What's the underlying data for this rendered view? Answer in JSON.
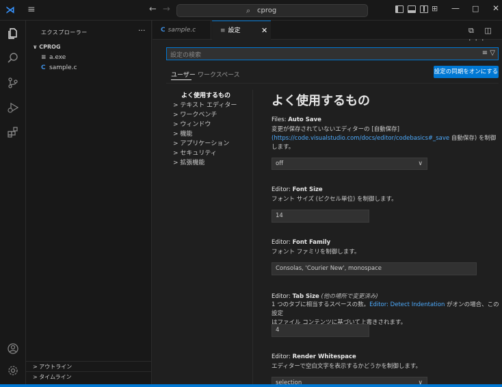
{
  "titlebar": {
    "search_text": "cprog",
    "back_label": "←",
    "forward_label": "→",
    "menu_glyph": "≡",
    "logo_glyph": "⋊",
    "layout_glyph": "⊞",
    "minimize_glyph": "—",
    "maximize_glyph": "□",
    "close_glyph": "✕"
  },
  "sidebar": {
    "title": "エクスプローラー",
    "more": "···",
    "folder": "∨ CPROG",
    "files": [
      {
        "icon": "≡",
        "name": "a.exe"
      },
      {
        "icon": "C",
        "name": "sample.c"
      }
    ],
    "sections": [
      "> アウトライン",
      "> タイムライン"
    ]
  },
  "tabs": [
    {
      "icon": "C",
      "label": "sample.c"
    },
    {
      "icon": "≡",
      "label": "設定",
      "close": "✕"
    }
  ],
  "tabs_actions": "⧉ ◫ ···",
  "settings": {
    "search_placeholder": "設定の検索",
    "search_icons": "≡ ▽",
    "scope_user": "ユーザー",
    "scope_workspace": "ワークスペース",
    "sync_button": "設定の同期をオンにする",
    "toc": [
      "よく使用するもの",
      "> テキスト エディター",
      "> ワークベンチ",
      "> ウィンドウ",
      "> 機能",
      "> アプリケーション",
      "> セキュリティ",
      "> 拡張機能"
    ],
    "section_title": "よく使用するもの",
    "items": {
      "autosave": {
        "category": "Files: ",
        "name": "Auto Save",
        "desc1": "変更が保存されていないエディターの [自動保存]",
        "link": "(https://code.visualstudio.com/docs/editor/codebasics#_save",
        "desc2": " 自動保存) を制御",
        "desc3": "します。",
        "value": "off"
      },
      "fontsize": {
        "category": "Editor: ",
        "name": "Font Size",
        "desc": "フォント サイズ (ピクセル単位) を制御します。",
        "value": "14"
      },
      "fontfamily": {
        "category": "Editor: ",
        "name": "Font Family",
        "desc": "フォント ファミリを制御します。",
        "value": "Consolas, 'Courier New', monospace"
      },
      "tabsize": {
        "category": "Editor: ",
        "name": "Tab Size",
        "modified": " (他の場所で変更済み)",
        "desc1": "1 つのタブに相当するスペースの数。",
        "link": "Editor: Detect Indentation",
        "desc2": " がオンの場合、この設定",
        "desc3": "はファイル コンテンツに基づいて上書きされます。",
        "value": "4"
      },
      "whitespace": {
        "category": "Editor: ",
        "name": "Render Whitespace",
        "desc": "エディターで空白文字を表示するかどうかを制御します。",
        "value": "selection"
      }
    }
  },
  "icons": {
    "explorer": "explorer-icon",
    "search": "search-icon",
    "scm": "source-control-icon",
    "debug": "run-debug-icon",
    "extensions": "extensions-icon",
    "account": "account-icon",
    "manage": "gear-icon"
  }
}
